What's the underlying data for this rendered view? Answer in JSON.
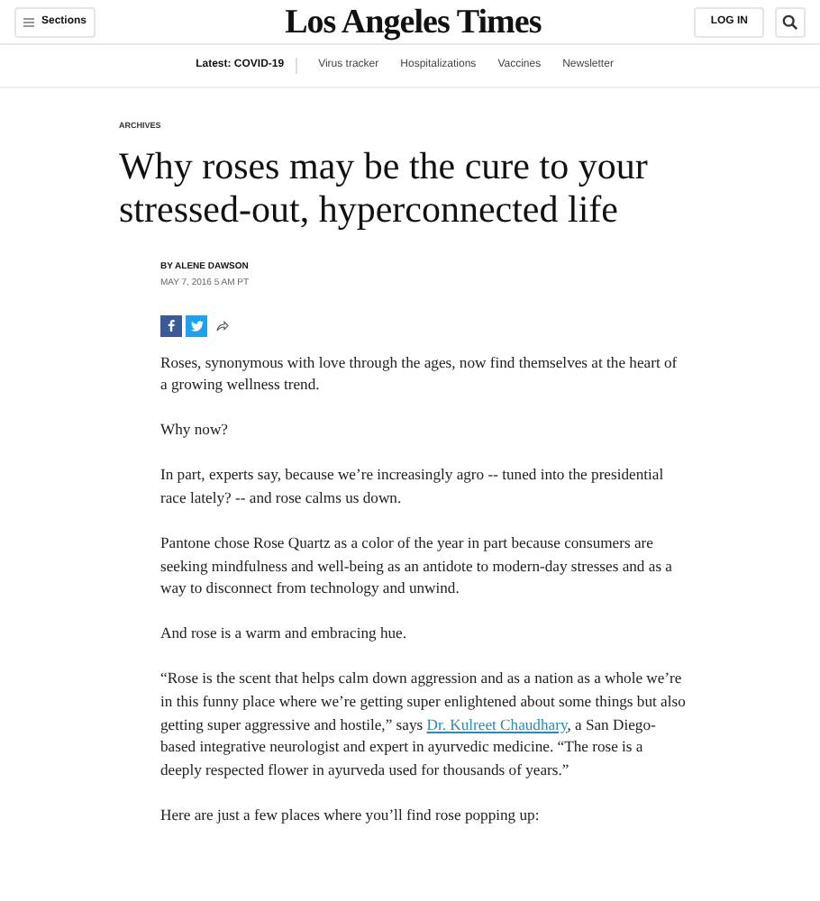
{
  "header": {
    "sections_button": "Sections",
    "logo": "Los Angeles Times",
    "login_button": "LOG IN"
  },
  "nav": {
    "latest": "Latest: COVID-19",
    "links": [
      "Virus tracker",
      "Hospitalizations",
      "Vaccines",
      "Newsletter"
    ]
  },
  "article": {
    "category": "ARCHIVES",
    "headline": "Why roses may be the cure to your stressed-out, hyperconnected life",
    "byline": "BY ALENE DAWSON",
    "date": "MAY 7, 2016 5 AM PT",
    "share": [
      {
        "kind": "facebook"
      },
      {
        "kind": "twitter"
      },
      {
        "kind": "share"
      }
    ],
    "paragraphs": [
      {
        "text": "Roses, synonymous with love through the ages, now find themselves at the heart of a growing wellness trend."
      },
      {
        "text": "Why now?"
      },
      {
        "text": "In part, experts say, because we’re increasingly agro -- tuned into the presidential race lately? -- and rose calms us down."
      },
      {
        "text": "Pantone chose Rose Quartz as a color of the year in part because consumers are seeking mindfulness and well-being as an antidote to modern-day stresses and as a way to disconnect from technology and unwind."
      },
      {
        "text": "And rose is a warm and embracing hue."
      },
      {
        "text": "“Rose is the scent that helps calm down aggression and as a nation as a whole we’re in this funny place where we’re getting super enlightened about some things but also getting super aggressive and hostile,” says ",
        "link": "Dr. Kulreet Chaudhary",
        "after": ", a San Diego-based integrative neurologist and expert in ayurvedic medicine. “The rose is a deeply respected flower in ayurveda used for thousands of years.”"
      },
      {
        "text": "Here are just a few places where you’ll find rose popping up:"
      }
    ]
  }
}
